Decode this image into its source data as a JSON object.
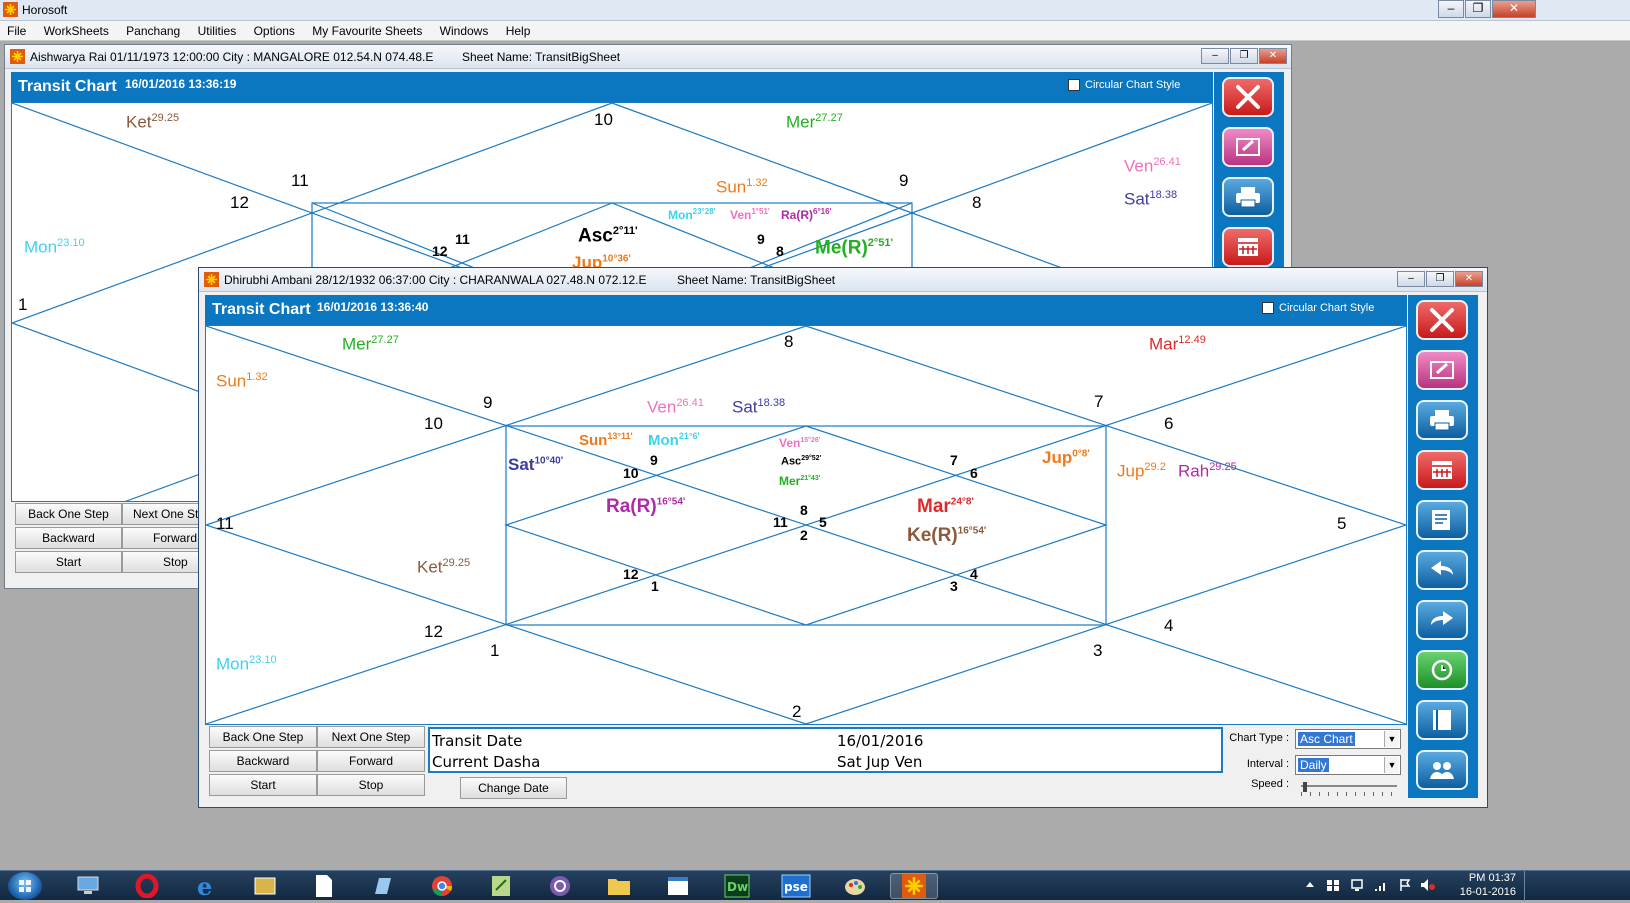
{
  "app": {
    "title": "Horosoft"
  },
  "menu": [
    "File",
    "WorkSheets",
    "Panchang",
    "Utilities",
    "Options",
    "My Favourite Sheets",
    "Windows",
    "Help"
  ],
  "windows": [
    {
      "info": "Aishwarya Rai 01/11/1973 12:00:00  City : MANGALORE 012.54.N 074.48.E",
      "sheet": "Sheet Name: TransitBigSheet",
      "chart_title": "Transit Chart",
      "chart_date": "16/01/2016 13:36:19",
      "circular_label": "Circular Chart Style",
      "controls": {
        "back": "Back One Step",
        "next": "Next One Step",
        "backward": "Backward",
        "forward": "Forward",
        "start": "Start",
        "stop": "Stop"
      },
      "houses": [
        "10",
        "11",
        "12",
        "1",
        "9",
        "8",
        "11",
        "12",
        "9",
        "8"
      ],
      "planets": [
        {
          "name": "Ket",
          "deg": "29.25",
          "color": "#8b5a3c"
        },
        {
          "name": "Mer",
          "deg": "27.27",
          "color": "#22b022"
        },
        {
          "name": "Ven",
          "deg": "26.41",
          "color": "#ee72be"
        },
        {
          "name": "Sat",
          "deg": "18.38",
          "color": "#3c3ca0"
        },
        {
          "name": "Sun",
          "deg": "1.32",
          "color": "#f07a18"
        },
        {
          "name": "Mon",
          "deg": "23.10",
          "color": "#3fd2f0"
        }
      ],
      "inner": [
        {
          "name": "Mon",
          "deg": "23°28'",
          "color": "#3fd2f0"
        },
        {
          "name": "Ven",
          "deg": "1°51'",
          "color": "#ee72be"
        },
        {
          "name": "Ra(R)",
          "deg": "6°16'",
          "color": "#b02aa8"
        },
        {
          "name": "Asc",
          "deg": "2°11'",
          "color": "#000000"
        },
        {
          "name": "Me(R)",
          "deg": "2°51'",
          "color": "#22b022"
        },
        {
          "name": "Jup",
          "deg": "10°36'",
          "color": "#f07a18"
        }
      ]
    },
    {
      "info": "Dhirubhi Ambani 28/12/1932 06:37:00  City : CHARANWALA 027.48.N 072.12.E",
      "sheet": "Sheet Name: TransitBigSheet",
      "chart_title": "Transit Chart",
      "chart_date": "16/01/2016 13:36:40",
      "circular_label": "Circular Chart Style",
      "controls": {
        "back": "Back One Step",
        "next": "Next One Step",
        "backward": "Backward",
        "forward": "Forward",
        "start": "Start",
        "stop": "Stop",
        "change_date": "Change Date"
      },
      "houses_outer": [
        "8",
        "9",
        "10",
        "11",
        "12",
        "1",
        "2",
        "3",
        "4",
        "5",
        "6",
        "7"
      ],
      "houses_inner": [
        "9",
        "10",
        "7",
        "6",
        "8",
        "11",
        "5",
        "2",
        "12",
        "1",
        "3",
        "4"
      ],
      "outer_planets": [
        {
          "name": "Mer",
          "deg": "27.27",
          "color": "#22b022"
        },
        {
          "name": "Sun",
          "deg": "1.32",
          "color": "#f07a18"
        },
        {
          "name": "Mar",
          "deg": "12.49",
          "color": "#e02a2a"
        },
        {
          "name": "Ven",
          "deg": "26.41",
          "color": "#ee72be"
        },
        {
          "name": "Sat",
          "deg": "18.38",
          "color": "#3c3ca0"
        },
        {
          "name": "Jup",
          "deg": "29.2",
          "color": "#f07a18"
        },
        {
          "name": "Rah",
          "deg": "29.25",
          "color": "#b02aa8"
        },
        {
          "name": "Ket",
          "deg": "29.25",
          "color": "#8b5a3c"
        },
        {
          "name": "Mon",
          "deg": "23.10",
          "color": "#3fd2f0"
        }
      ],
      "inner_planets": [
        {
          "name": "Sun",
          "deg": "13°11'",
          "color": "#f07a18"
        },
        {
          "name": "Mon",
          "deg": "21°6'",
          "color": "#3fd2f0"
        },
        {
          "name": "Sat",
          "deg": "10°40'",
          "color": "#3c3ca0"
        },
        {
          "name": "Ven",
          "deg": "15°26'",
          "color": "#ee72be"
        },
        {
          "name": "Asc",
          "deg": "29°52'",
          "color": "#000000"
        },
        {
          "name": "Mer",
          "deg": "21°43'",
          "color": "#22b022"
        },
        {
          "name": "Jup",
          "deg": "0°8'",
          "color": "#f07a18"
        },
        {
          "name": "Ra(R)",
          "deg": "16°54'",
          "color": "#b02aa8"
        },
        {
          "name": "Mar",
          "deg": "24°8'",
          "color": "#e02a2a"
        },
        {
          "name": "Ke(R)",
          "deg": "16°54'",
          "color": "#8b5a3c"
        }
      ],
      "transit": {
        "date_label": "Transit Date",
        "date_value": "16/01/2016",
        "dasha_label": "Current Dasha",
        "dasha_value": "Sat Jup Ven"
      },
      "settings": {
        "chart_type_label": "Chart Type :",
        "chart_type_value": "Asc Chart",
        "interval_label": "Interval :",
        "interval_value": "Daily",
        "speed_label": "Speed :"
      }
    }
  ],
  "toolbar_icons": [
    "tools-icon",
    "edit-icon",
    "print-icon",
    "calendar-icon",
    "notes-icon",
    "back-arrow-icon",
    "forward-arrow-icon",
    "clock-icon",
    "book-icon",
    "people-icon"
  ],
  "taskbar": {
    "time": "PM 01:37",
    "date": "16-01-2016"
  },
  "colors": {
    "chart_line": "#1a7ac3",
    "header_blue": "#0b77c0"
  }
}
